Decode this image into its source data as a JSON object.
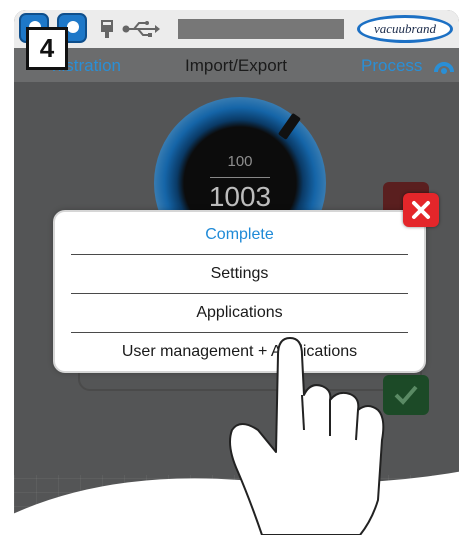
{
  "step_label": "4",
  "topbar": {
    "buttons": [
      "user-icon",
      "lock-icon"
    ],
    "icons": [
      "lan-icon",
      "usb-icon"
    ],
    "brand": "vacuubrand"
  },
  "tabs": [
    {
      "label": "nistration"
    },
    {
      "label": "Import/Export"
    },
    {
      "label": "Process"
    }
  ],
  "gauge": {
    "setpoint": "100",
    "value": "1003"
  },
  "popup": {
    "options": [
      {
        "label": "Complete",
        "selected": true
      },
      {
        "label": "Settings"
      },
      {
        "label": "Applications"
      },
      {
        "label": "User management + Applications"
      }
    ],
    "close_icon": "close-icon"
  },
  "colors": {
    "accent": "#1f8ad7",
    "close": "#e4262a",
    "confirm": "#1c4a27"
  }
}
